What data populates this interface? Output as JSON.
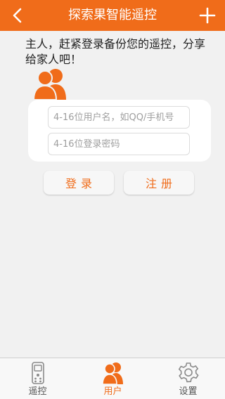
{
  "colors": {
    "accent": "#f06c1a",
    "background": "#f1f1f1",
    "card": "#ffffff"
  },
  "navbar": {
    "title": "探索果智能遥控",
    "back_icon": "chevron-left-icon",
    "add_icon": "plus-icon"
  },
  "intro": {
    "text": "主人，赶紧登录备份您的遥控，分享给家人吧！"
  },
  "avatar": {
    "icon": "users-icon"
  },
  "login_form": {
    "username_placeholder": "4-16位用户名，如QQ/手机号",
    "username_value": "",
    "password_placeholder": "4-16位登录密码",
    "password_value": ""
  },
  "buttons": {
    "login_label": "登录",
    "register_label": "注册"
  },
  "tabbar": {
    "items": [
      {
        "label": "遥控",
        "icon": "remote-control-icon",
        "active": false
      },
      {
        "label": "用户",
        "icon": "users-icon",
        "active": true
      },
      {
        "label": "设置",
        "icon": "gear-icon",
        "active": false
      }
    ]
  }
}
